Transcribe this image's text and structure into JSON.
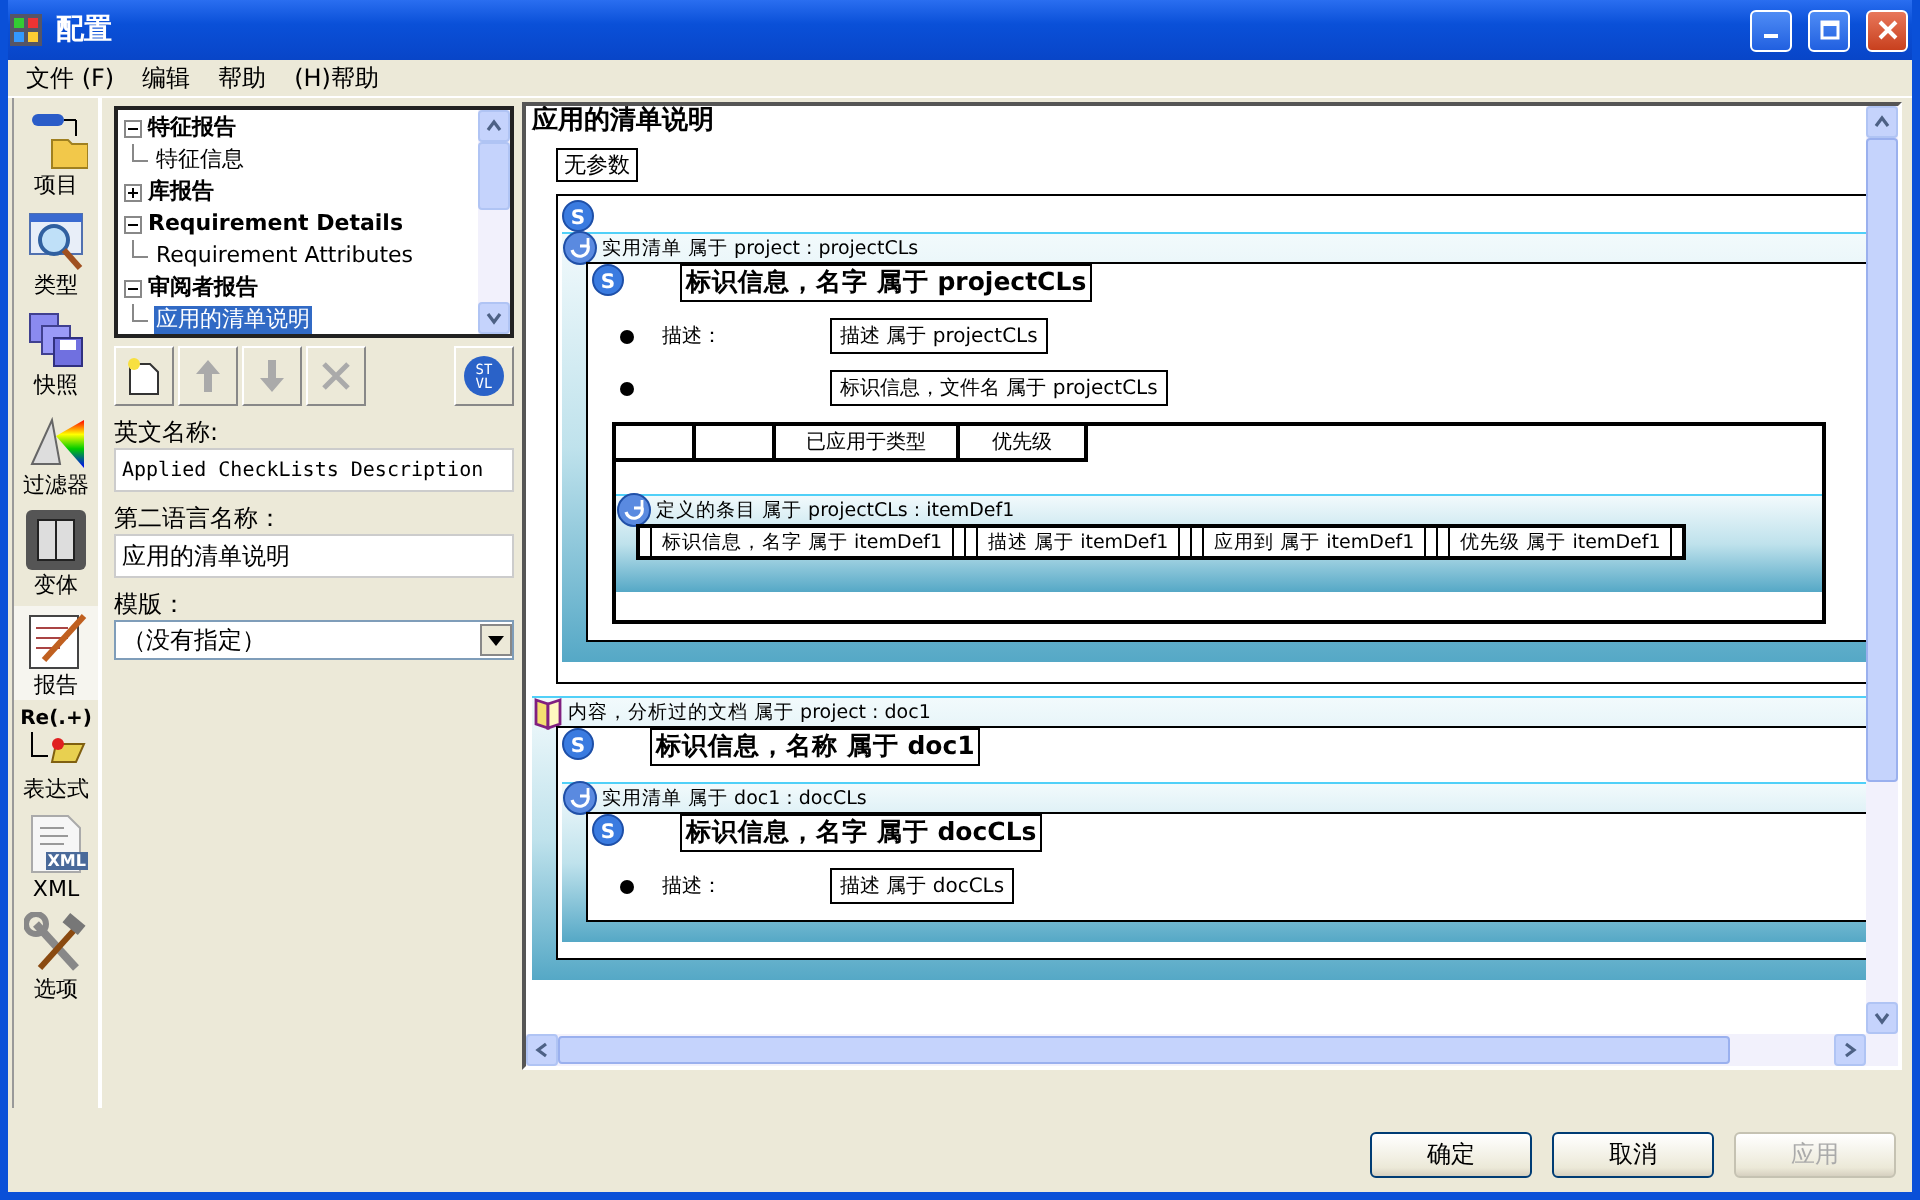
{
  "window": {
    "title": "配置"
  },
  "menu": [
    "文件 (F)",
    "编辑",
    "帮助",
    "(H)帮助"
  ],
  "sidebar": [
    {
      "label": "项目",
      "kind": "project",
      "selected": false
    },
    {
      "label": "类型",
      "kind": "type",
      "selected": false
    },
    {
      "label": "快照",
      "kind": "snapshot",
      "selected": false
    },
    {
      "label": "过滤器",
      "kind": "filter",
      "selected": false
    },
    {
      "label": "变体",
      "kind": "variant",
      "selected": false
    },
    {
      "label": "报告",
      "kind": "report",
      "selected": true
    },
    {
      "label": "表达式",
      "kind": "regex",
      "selected": false,
      "icon_text": "Re(.+)"
    },
    {
      "label": "XML",
      "kind": "xml",
      "selected": false,
      "icon_text": "XML"
    },
    {
      "label": "选项",
      "kind": "tools",
      "selected": false
    }
  ],
  "tree": [
    {
      "label": "特征报告",
      "expanded": true,
      "selected": false,
      "children": [
        {
          "label": "特征信息",
          "selected": false
        }
      ]
    },
    {
      "label": "库报告",
      "expanded": false,
      "selected": false
    },
    {
      "label": "Requirement Details",
      "expanded": true,
      "selected": false,
      "children": [
        {
          "label": "Requirement Attributes",
          "selected": false
        }
      ]
    },
    {
      "label": "审阅者报告",
      "expanded": true,
      "selected": false,
      "children": [
        {
          "label": "应用的清单说明",
          "selected": true
        }
      ]
    }
  ],
  "toolbar": [
    {
      "kind": "new",
      "disabled": false
    },
    {
      "kind": "up",
      "disabled": true
    },
    {
      "kind": "down",
      "disabled": true
    },
    {
      "kind": "delete",
      "disabled": true
    }
  ],
  "style_button": {
    "line1": "ST",
    "line2": "VL"
  },
  "fields": [
    {
      "label": "英文名称:",
      "value": "Applied CheckLists Description",
      "kind": "text"
    },
    {
      "label": "第二语言名称：",
      "value": "应用的清单说明",
      "kind": "text"
    },
    {
      "label": "模版：",
      "value": "（没有指定）",
      "kind": "dropdown"
    }
  ],
  "preview": {
    "title": "应用的清单说明",
    "note": "无参数",
    "sections": [
      {
        "kind": "frame",
        "badge": "S",
        "children": [
          {
            "kind": "checklist_band",
            "label": "实用清单 属于 project : projectCLs",
            "children": [
              {
                "kind": "heading",
                "badge": "S",
                "text": "标识信息，名字 属于 projectCLs"
              },
              {
                "kind": "bullet",
                "label": "描述：",
                "value": "描述 属于 projectCLs"
              },
              {
                "kind": "bullet",
                "value": "标识信息，文件名 属于 projectCLs"
              },
              {
                "kind": "table",
                "headers": [
                  "已应用于类型",
                  "优先级"
                ],
                "band": {
                  "label": "定义的条目 属于 projectCLs : itemDef1",
                  "cells": [
                    "标识信息，名字 属于 itemDef1",
                    "描述 属于 itemDef1",
                    "应用到 属于 itemDef1",
                    "优先级 属于 itemDef1"
                  ]
                }
              }
            ]
          }
        ]
      },
      {
        "kind": "document_band",
        "label": "内容，分析过的文档 属于 project : doc1",
        "children": [
          {
            "kind": "heading",
            "badge": "S",
            "text": "标识信息，名称 属于 doc1"
          },
          {
            "kind": "checklist_band",
            "label": "实用清单 属于 doc1 : docCLs",
            "children": [
              {
                "kind": "heading",
                "badge": "S",
                "text": "标识信息，名字 属于 docCLs"
              },
              {
                "kind": "bullet",
                "label": "描述：",
                "value": "描述 属于 docCLs"
              }
            ]
          }
        ]
      }
    ]
  },
  "buttons": [
    {
      "label": "确定",
      "disabled": false
    },
    {
      "label": "取消",
      "disabled": false
    },
    {
      "label": "应用",
      "disabled": true
    }
  ]
}
